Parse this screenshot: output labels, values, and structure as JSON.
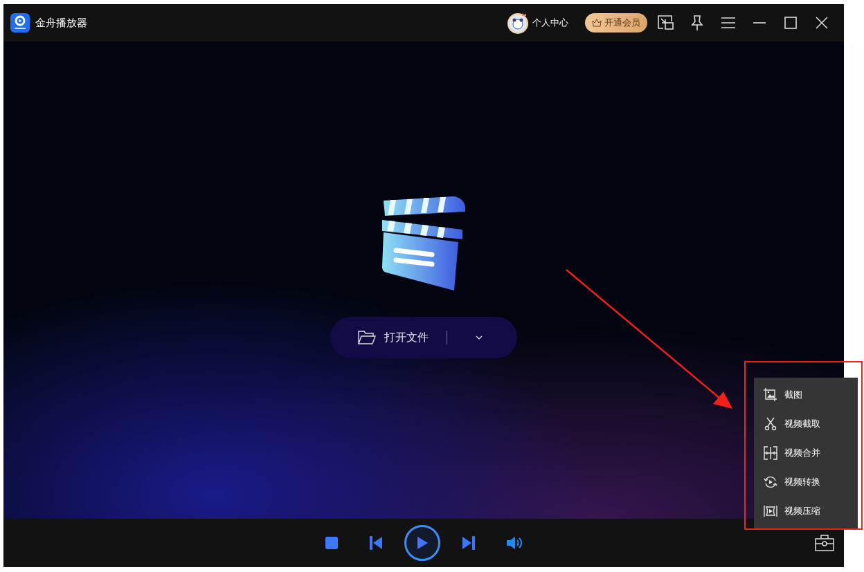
{
  "window": {
    "title": "金舟播放器"
  },
  "header": {
    "user_center": "个人中心",
    "vip_button": "开通会员"
  },
  "open_file": {
    "label": "打开文件"
  },
  "tools_menu": [
    {
      "kind": "screenshot",
      "label": "截图"
    },
    {
      "kind": "cut",
      "label": "视频截取"
    },
    {
      "kind": "merge",
      "label": "视频合并"
    },
    {
      "kind": "convert",
      "label": "视频转换"
    },
    {
      "kind": "compress",
      "label": "视频压缩"
    }
  ],
  "annotation": {
    "arrow": true,
    "highlight_frame": true
  }
}
